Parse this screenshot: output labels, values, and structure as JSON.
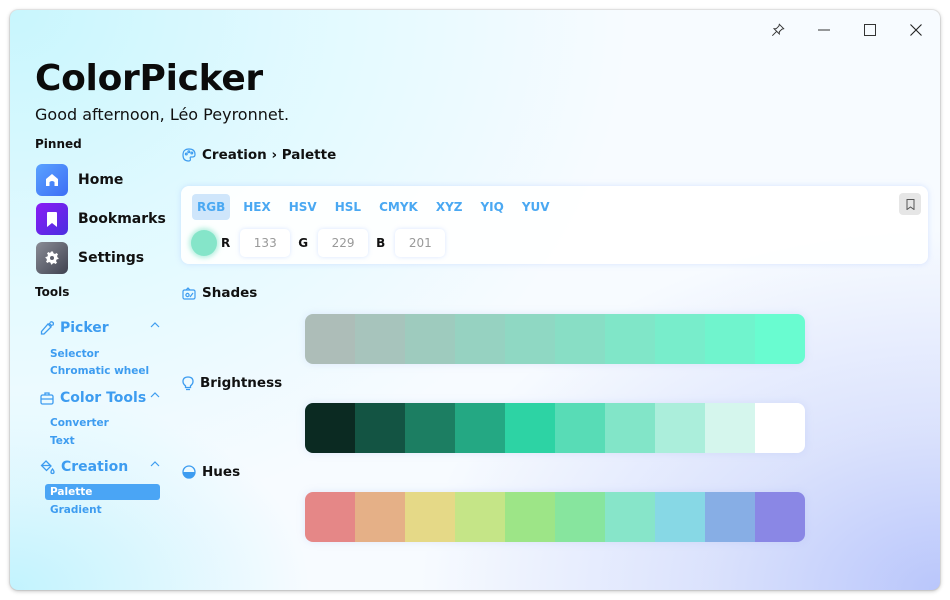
{
  "window": {
    "controls": {
      "pin": "pin-icon",
      "minimize": "minimize-icon",
      "maximize": "maximize-icon",
      "close": "close-icon"
    }
  },
  "header": {
    "title": "ColorPicker",
    "greeting": "Good afternoon, Léo Peyronnet."
  },
  "sidebar": {
    "pinned_label": "Pinned",
    "pinned": [
      {
        "label": "Home",
        "icon": "home-icon",
        "color_from": "#5aa2ff",
        "color_to": "#3d6ef5"
      },
      {
        "label": "Bookmarks",
        "icon": "bookmark-icon",
        "color_from": "#8a1cf5",
        "color_to": "#4a2ee0"
      },
      {
        "label": "Settings",
        "icon": "gear-icon",
        "color_from": "#8a8d96",
        "color_to": "#3f4250"
      }
    ],
    "tools_label": "Tools",
    "groups": [
      {
        "label": "Picker",
        "icon": "eyedropper-icon",
        "expanded": true,
        "items": [
          "Selector",
          "Chromatic wheel"
        ]
      },
      {
        "label": "Color Tools",
        "icon": "toolbox-icon",
        "expanded": true,
        "items": [
          "Converter",
          "Text"
        ]
      },
      {
        "label": "Creation",
        "icon": "paint-bucket-icon",
        "expanded": true,
        "items": [
          "Palette",
          "Gradient"
        ],
        "active_item": "Palette"
      }
    ]
  },
  "breadcrumb": {
    "icon": "palette-icon",
    "text": "Creation › Palette"
  },
  "color_card": {
    "tabs": [
      "RGB",
      "HEX",
      "HSV",
      "HSL",
      "CMYK",
      "XYZ",
      "YIQ",
      "YUV"
    ],
    "active_tab": "RGB",
    "current_color": "#85e5c9",
    "channels": [
      {
        "label": "R",
        "value": "133"
      },
      {
        "label": "G",
        "value": "229"
      },
      {
        "label": "B",
        "value": "201"
      }
    ],
    "bookmark_button": "bookmark-outline-icon"
  },
  "sections": {
    "shades": {
      "title": "Shades",
      "icon": "shades-icon",
      "colors": [
        "#adbdb8",
        "#a7c4bc",
        "#9ecbbe",
        "#96d2c1",
        "#8fd8c3",
        "#88dec5",
        "#80e6c8",
        "#78edcb",
        "#70f4cd",
        "#69fcd0"
      ]
    },
    "brightness": {
      "title": "Brightness",
      "icon": "lightbulb-icon",
      "colors": [
        "#0b2a22",
        "#135443",
        "#1c7e62",
        "#24a883",
        "#2dd3a4",
        "#58dcb6",
        "#82e5c8",
        "#abeedb",
        "#d5f6ed",
        "#ffffff"
      ]
    },
    "hues": {
      "title": "Hues",
      "icon": "half-circle-icon",
      "colors": [
        "#e58787",
        "#e5b087",
        "#e5d987",
        "#c5e587",
        "#9de587",
        "#87e59e",
        "#87e5c9",
        "#87d8e5",
        "#87aee5",
        "#8a87e5"
      ]
    }
  }
}
